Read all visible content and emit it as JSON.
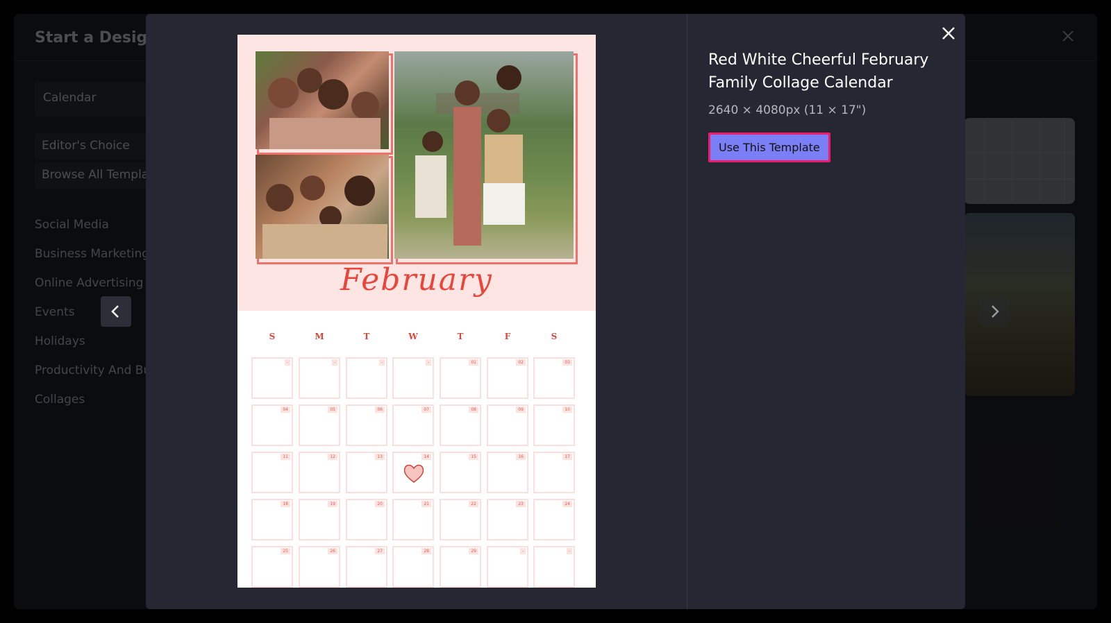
{
  "background": {
    "header_title": "Start a Design",
    "search_value": "Calendar",
    "filters": [
      "Editor's Choice",
      "Browse All Templates"
    ],
    "nav": [
      "Social Media",
      "Business Marketing",
      "Online Advertising",
      "Events",
      "Holidays",
      "Productivity And Business",
      "Collages"
    ]
  },
  "modal": {
    "template_title": "Red White Cheerful February Family Collage Calendar",
    "template_size": "2640 × 4080px (11 × 17\")",
    "use_button": "Use This Template"
  },
  "calendar": {
    "month": "February",
    "weekdays": [
      "S",
      "M",
      "T",
      "W",
      "T",
      "F",
      "S"
    ],
    "weeks": [
      [
        "-",
        "-",
        "-",
        "-",
        "01",
        "02",
        "03"
      ],
      [
        "04",
        "05",
        "06",
        "07",
        "08",
        "09",
        "10"
      ],
      [
        "11",
        "12",
        "13",
        "14",
        "15",
        "16",
        "17"
      ],
      [
        "18",
        "19",
        "20",
        "21",
        "22",
        "23",
        "24"
      ],
      [
        "25",
        "26",
        "27",
        "28",
        "29",
        "-",
        "-"
      ]
    ],
    "heart_date": "14"
  },
  "colors": {
    "accent_button": "#7b7ff5",
    "focus_outline": "#f0196a",
    "calendar_red": "#e8463a",
    "calendar_pink": "#fde5e3"
  },
  "icons": {
    "close": "close-icon",
    "prev": "chevron-left-icon",
    "next": "chevron-right-icon",
    "heart": "heart-icon"
  }
}
